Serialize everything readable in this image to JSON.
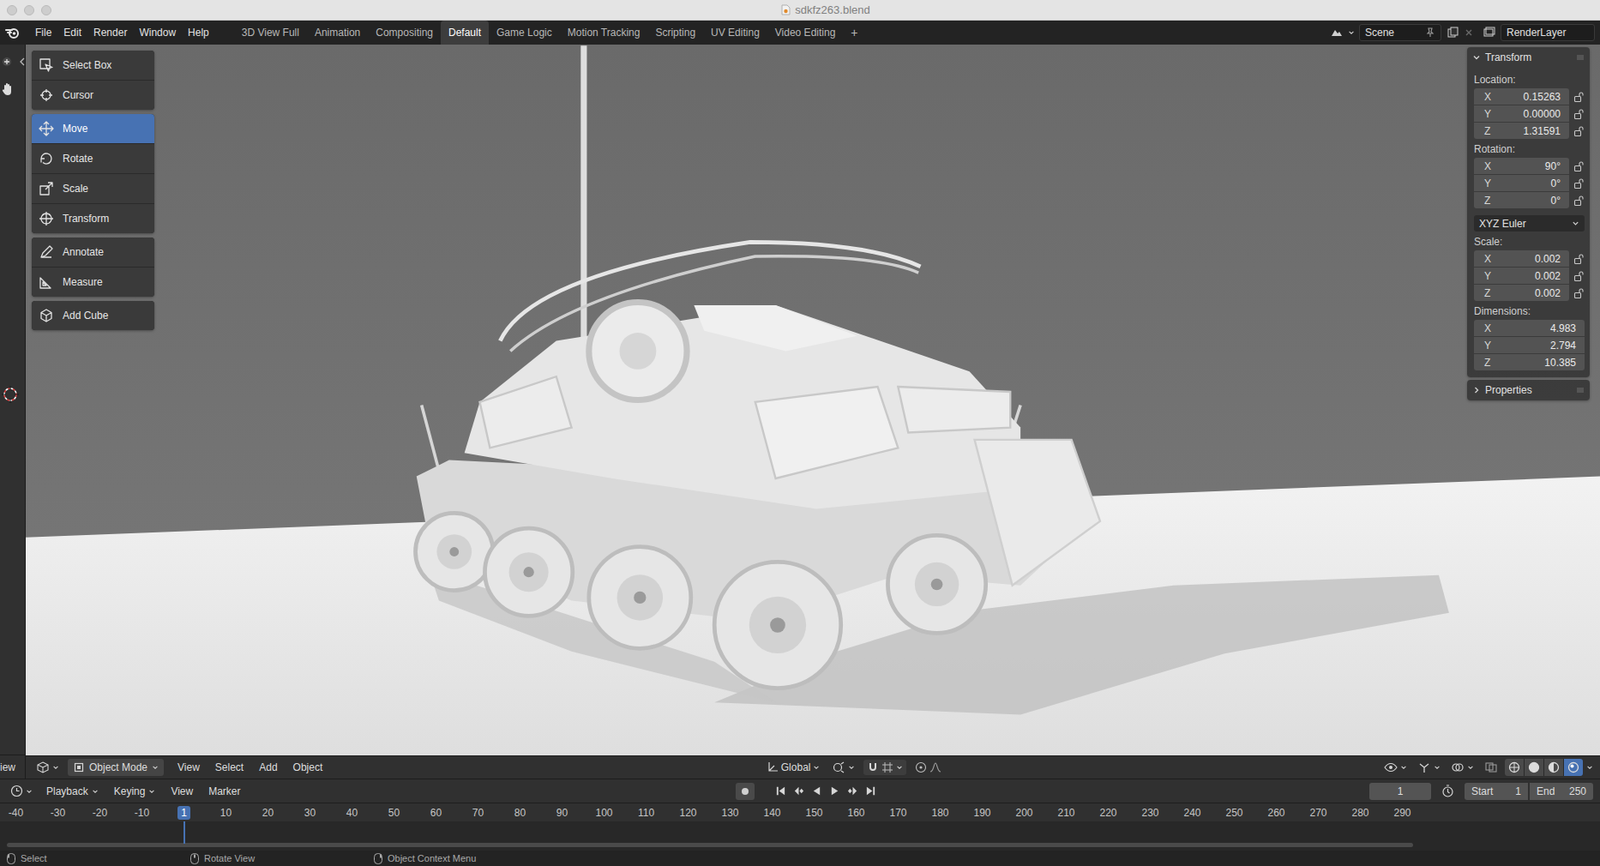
{
  "window": {
    "title": "sdkfz263.blend"
  },
  "menu": [
    "File",
    "Edit",
    "Render",
    "Window",
    "Help"
  ],
  "workspaces": [
    {
      "label": "3D View Full",
      "selected": false
    },
    {
      "label": "Animation",
      "selected": false
    },
    {
      "label": "Compositing",
      "selected": false
    },
    {
      "label": "Default",
      "selected": true
    },
    {
      "label": "Game Logic",
      "selected": false
    },
    {
      "label": "Motion Tracking",
      "selected": false
    },
    {
      "label": "Scripting",
      "selected": false
    },
    {
      "label": "UV Editing",
      "selected": false
    },
    {
      "label": "Video Editing",
      "selected": false
    }
  ],
  "add_workspace": "+",
  "scene": "Scene",
  "view_layer": "RenderLayer",
  "tool_groups": [
    {
      "tools": [
        {
          "label": "Select Box",
          "selected": false
        },
        {
          "label": "Cursor",
          "selected": false
        }
      ]
    },
    {
      "tools": [
        {
          "label": "Move",
          "selected": true
        },
        {
          "label": "Rotate",
          "selected": false
        },
        {
          "label": "Scale",
          "selected": false
        },
        {
          "label": "Transform",
          "selected": false
        }
      ]
    },
    {
      "tools": [
        {
          "label": "Annotate",
          "selected": false
        },
        {
          "label": "Measure",
          "selected": false
        }
      ]
    },
    {
      "tools": [
        {
          "label": "Add Cube",
          "selected": false
        }
      ]
    }
  ],
  "transform_panel": {
    "title": "Transform",
    "expanded": true,
    "sections": [
      {
        "label": "Location:",
        "lockable": true,
        "fields": [
          {
            "axis": "X",
            "value": "0.15263",
            "locked": false
          },
          {
            "axis": "Y",
            "value": "0.00000",
            "locked": false
          },
          {
            "axis": "Z",
            "value": "1.31591",
            "locked": false
          }
        ]
      },
      {
        "label": "Rotation:",
        "lockable": true,
        "fields": [
          {
            "axis": "X",
            "value": "90°",
            "locked": false
          },
          {
            "axis": "Y",
            "value": "0°",
            "locked": false
          },
          {
            "axis": "Z",
            "value": "0°",
            "locked": false
          }
        ],
        "mode": "XYZ Euler"
      },
      {
        "label": "Scale:",
        "lockable": true,
        "fields": [
          {
            "axis": "X",
            "value": "0.002",
            "locked": false
          },
          {
            "axis": "Y",
            "value": "0.002",
            "locked": false
          },
          {
            "axis": "Z",
            "value": "0.002",
            "locked": false
          }
        ]
      },
      {
        "label": "Dimensions:",
        "lockable": false,
        "fields": [
          {
            "axis": "X",
            "value": "4.983",
            "locked": false
          },
          {
            "axis": "Y",
            "value": "2.794",
            "locked": false
          },
          {
            "axis": "Z",
            "value": "10.385",
            "locked": false
          }
        ]
      }
    ]
  },
  "properties_panel": {
    "title": "Properties",
    "expanded": false
  },
  "left_editor": {
    "header_label": "iew"
  },
  "viewport_header": {
    "mode": "Object Mode",
    "menus": [
      "View",
      "Select",
      "Add",
      "Object"
    ],
    "orientation": "Global",
    "shading": [
      {
        "selected": false
      },
      {
        "selected": false
      },
      {
        "selected": false
      },
      {
        "selected": true
      }
    ]
  },
  "timeline_header": {
    "menus": [
      {
        "label": "Playback",
        "dropdown": true
      },
      {
        "label": "Keying",
        "dropdown": true
      },
      {
        "label": "View",
        "dropdown": false
      },
      {
        "label": "Marker",
        "dropdown": false
      }
    ],
    "current_frame": "1",
    "start_label": "Start",
    "start": "1",
    "end_label": "End",
    "end": "250"
  },
  "ruler": [
    {
      "label": "-40",
      "selected": false
    },
    {
      "label": "-30",
      "selected": false
    },
    {
      "label": "-20",
      "selected": false
    },
    {
      "label": "-10",
      "selected": false
    },
    {
      "label": "1",
      "selected": true
    },
    {
      "label": "10",
      "selected": false
    },
    {
      "label": "20",
      "selected": false
    },
    {
      "label": "30",
      "selected": false
    },
    {
      "label": "40",
      "selected": false
    },
    {
      "label": "50",
      "selected": false
    },
    {
      "label": "60",
      "selected": false
    },
    {
      "label": "70",
      "selected": false
    },
    {
      "label": "80",
      "selected": false
    },
    {
      "label": "90",
      "selected": false
    },
    {
      "label": "100",
      "selected": false
    },
    {
      "label": "110",
      "selected": false
    },
    {
      "label": "120",
      "selected": false
    },
    {
      "label": "130",
      "selected": false
    },
    {
      "label": "140",
      "selected": false
    },
    {
      "label": "150",
      "selected": false
    },
    {
      "label": "160",
      "selected": false
    },
    {
      "label": "170",
      "selected": false
    },
    {
      "label": "180",
      "selected": false
    },
    {
      "label": "190",
      "selected": false
    },
    {
      "label": "200",
      "selected": false
    },
    {
      "label": "210",
      "selected": false
    },
    {
      "label": "220",
      "selected": false
    },
    {
      "label": "230",
      "selected": false
    },
    {
      "label": "240",
      "selected": false
    },
    {
      "label": "250",
      "selected": false
    },
    {
      "label": "260",
      "selected": false
    },
    {
      "label": "270",
      "selected": false
    },
    {
      "label": "280",
      "selected": false
    },
    {
      "label": "290",
      "selected": false
    }
  ],
  "status_bar": [
    "Select",
    "Rotate View",
    "Object Context Menu"
  ]
}
